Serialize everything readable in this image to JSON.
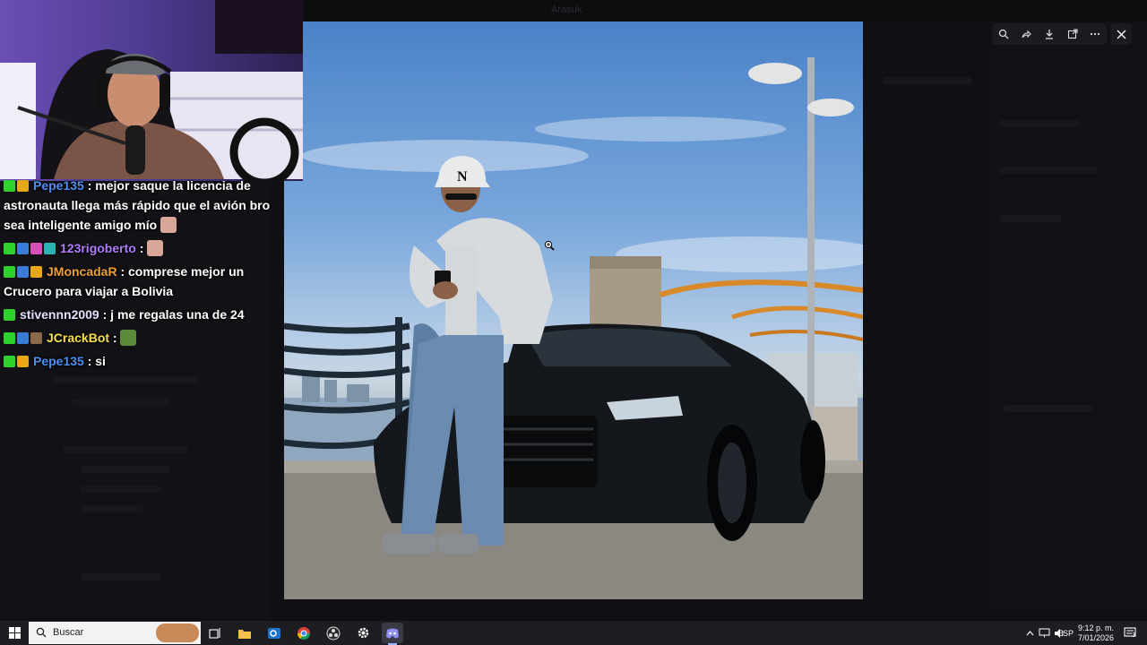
{
  "window": {
    "title": "Arasuk"
  },
  "viewer": {
    "toolbar": [
      "zoom-icon",
      "share-icon",
      "download-icon",
      "open-external-icon",
      "more-icon"
    ],
    "close": "close-icon",
    "letter_on_cap": "N"
  },
  "chat": {
    "messages": [
      {
        "user": "Pepe135",
        "user_color": "#4d8ff0",
        "badges": [
          "#2fd12f",
          "#e6a817"
        ],
        "text": ": mejor saque la licencia de astronauta llega más rápido que el avión bro sea inteligente amigo mío",
        "emote": "#d9a79a"
      },
      {
        "user": "123rigoberto",
        "user_color": "#b27cff",
        "badges": [
          "#2fd12f",
          "#3a7bd5",
          "#d94fb8",
          "#2bb3b3"
        ],
        "text": ":",
        "emote": "#d9a79a"
      },
      {
        "user": "JMoncadaR",
        "user_color": "#f0a030",
        "badges": [
          "#2fd12f",
          "#3a7bd5",
          "#e6a817"
        ],
        "text": ": comprese mejor un Crucero para viajar a Bolivia",
        "emote": null
      },
      {
        "user": "stivennn2009",
        "user_color": "#e8e0ff",
        "badges": [
          "#2fd12f"
        ],
        "text": ": j me regalas una de 24",
        "emote": null
      },
      {
        "user": "JCrackBot",
        "user_color": "#f5e04a",
        "badges": [
          "#2fd12f",
          "#3a7bd5",
          "#8a6a4a"
        ],
        "text": ":",
        "emote": "#5a8a3a"
      },
      {
        "user": "Pepe135",
        "user_color": "#4d8ff0",
        "badges": [
          "#2fd12f",
          "#e6a817"
        ],
        "text": ": si",
        "emote": null
      }
    ]
  },
  "taskbar": {
    "search_placeholder": "Buscar",
    "apps": [
      "task-view-icon",
      "file-explorer-icon",
      "outlook-icon",
      "chrome-icon",
      "obs-icon",
      "settings-icon",
      "discord-icon"
    ],
    "tray": {
      "language": "ESP",
      "time": "9:12 p. m.",
      "date": "7/01/2026",
      "notifications": "3"
    }
  }
}
